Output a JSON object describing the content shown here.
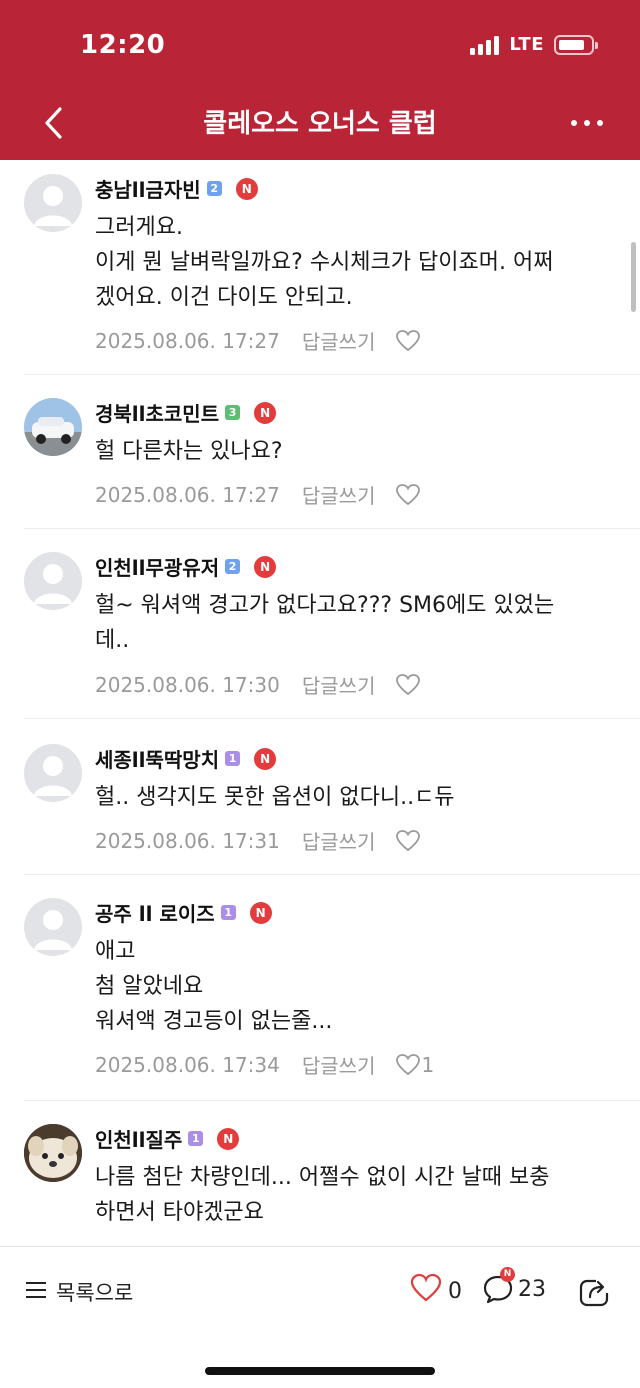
{
  "status_bar": {
    "time": "12:20",
    "network": "LTE"
  },
  "header": {
    "title": "콜레오스 오너스 클럽"
  },
  "comments": [
    {
      "author": "충남ll금자빈",
      "level": "2",
      "new_badge": "N",
      "lines": [
        "그러게요.",
        "이게 뭔 날벼락일까요? 수시체크가 답이죠머. 어쩌",
        "겠어요. 이건 다이도 안되고."
      ],
      "date": "2025.08.06. 17:27",
      "reply": "답글쓰기",
      "likes": ""
    },
    {
      "author": "경북ll초코민트",
      "level": "3",
      "new_badge": "N",
      "lines": [
        "헐 다른차는 있나요?"
      ],
      "date": "2025.08.06. 17:27",
      "reply": "답글쓰기",
      "likes": ""
    },
    {
      "author": "인천ll무광유저",
      "level": "2",
      "new_badge": "N",
      "lines": [
        "헐~ 워셔액 경고가 없다고요??? SM6에도 있었는",
        "데.."
      ],
      "date": "2025.08.06. 17:30",
      "reply": "답글쓰기",
      "likes": ""
    },
    {
      "author": "세종ll뚝딱망치",
      "level": "1",
      "new_badge": "N",
      "lines": [
        "헐.. 생각지도 못한 옵션이 없다니..ㄷ듀"
      ],
      "date": "2025.08.06. 17:31",
      "reply": "답글쓰기",
      "likes": ""
    },
    {
      "author": "공주 ll 로이즈",
      "level": "1",
      "new_badge": "N",
      "lines": [
        "애고",
        "첨 알았네요",
        "워셔액 경고등이 없는줄..."
      ],
      "date": "2025.08.06. 17:34",
      "reply": "답글쓰기",
      "likes": "1"
    },
    {
      "author": "인천ll질주",
      "level": "1",
      "new_badge": "N",
      "lines": [
        "나름 첨단 차량인데... 어쩔수 없이 시간 날때 보충",
        "하면서 타야겠군요"
      ],
      "date": "",
      "reply": "",
      "likes": ""
    }
  ],
  "bottom_bar": {
    "list_label": "목록으로",
    "like_count": "0",
    "comment_count": "23",
    "comment_badge": "N"
  },
  "colors": {
    "brand": "#b92436",
    "badge_red": "#e23c3c",
    "level_blue": "#6fa2ea",
    "level_green": "#5dbd73",
    "level_purple": "#ab8ee6"
  },
  "icons": [
    "back-arrow-icon",
    "more-icon",
    "heart-icon",
    "comment-icon",
    "share-icon",
    "list-icon"
  ]
}
